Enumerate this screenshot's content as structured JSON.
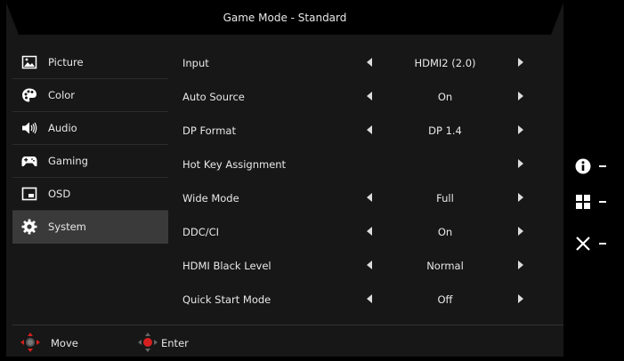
{
  "header": {
    "title": "Game Mode - Standard"
  },
  "sidebar": {
    "items": [
      {
        "label": "Picture",
        "icon": "picture-icon",
        "active": false
      },
      {
        "label": "Color",
        "icon": "palette-icon",
        "active": false
      },
      {
        "label": "Audio",
        "icon": "speaker-icon",
        "active": false
      },
      {
        "label": "Gaming",
        "icon": "gamepad-icon",
        "active": false
      },
      {
        "label": "OSD",
        "icon": "osd-icon",
        "active": false
      },
      {
        "label": "System",
        "icon": "gear-icon",
        "active": true
      }
    ]
  },
  "settings": {
    "rows": [
      {
        "name": "Input",
        "value": "HDMI2 (2.0)",
        "left_arrow": true,
        "right_arrow": true
      },
      {
        "name": "Auto Source",
        "value": "On",
        "left_arrow": true,
        "right_arrow": true
      },
      {
        "name": "DP Format",
        "value": "DP 1.4",
        "left_arrow": true,
        "right_arrow": true
      },
      {
        "name": "Hot Key Assignment",
        "value": "",
        "left_arrow": false,
        "right_arrow": true
      },
      {
        "name": "Wide Mode",
        "value": "Full",
        "left_arrow": true,
        "right_arrow": true
      },
      {
        "name": "DDC/CI",
        "value": "On",
        "left_arrow": true,
        "right_arrow": true
      },
      {
        "name": "HDMI Black Level",
        "value": "Normal",
        "left_arrow": true,
        "right_arrow": true
      },
      {
        "name": "Quick Start Mode",
        "value": "Off",
        "left_arrow": true,
        "right_arrow": true
      }
    ]
  },
  "footer": {
    "move_label": "Move",
    "enter_label": "Enter"
  },
  "keys": [
    {
      "icon": "info-icon"
    },
    {
      "icon": "menu-grid-icon"
    },
    {
      "icon": "close-icon"
    }
  ],
  "colors": {
    "accent": "#d61f1f",
    "panel": "#171717",
    "active_item": "#3a3a3a"
  }
}
